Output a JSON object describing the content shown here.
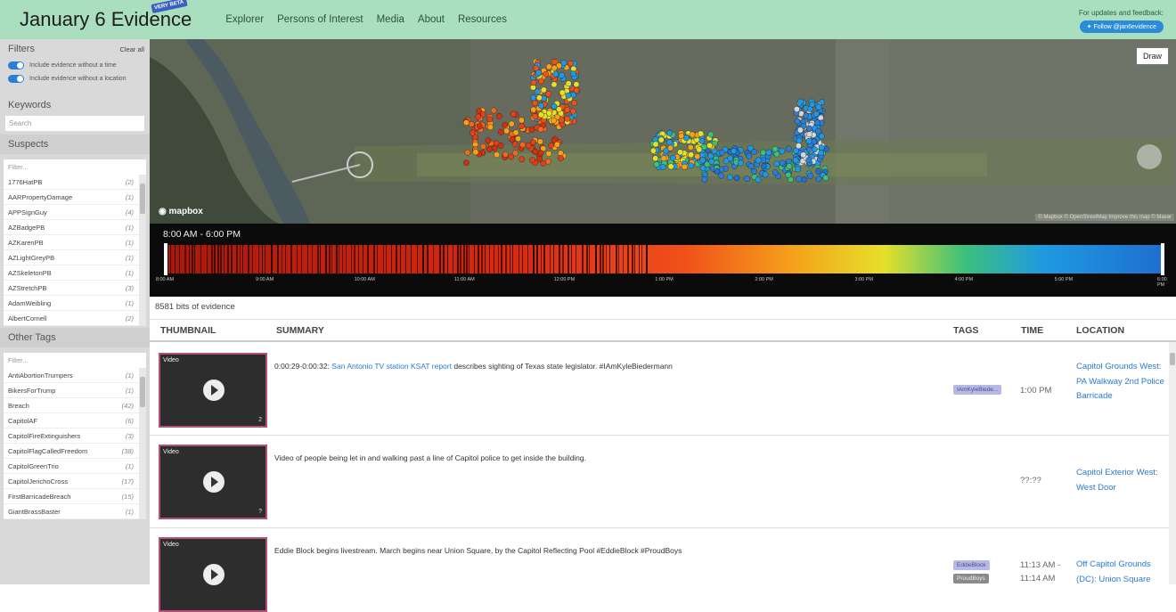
{
  "header": {
    "title": "January 6 Evidence",
    "beta_badge": "VERY BETA",
    "nav": [
      "Explorer",
      "Persons of Interest",
      "Media",
      "About",
      "Resources"
    ],
    "updates_text": "For updates and feedback:",
    "follow_label": "Follow @jan6evidence"
  },
  "sidebar": {
    "filters_title": "Filters",
    "clear_all": "Clear all",
    "toggles": [
      "Include evidence without a time",
      "Include evidence without a location"
    ],
    "keywords_title": "Keywords",
    "search_placeholder": "Search",
    "suspects_title": "Suspects",
    "suspects_filter": "Filter...",
    "suspects": [
      {
        "name": "1776HatPB",
        "count": "(2)"
      },
      {
        "name": "AARPropertyDamage",
        "count": "(1)"
      },
      {
        "name": "APPSignGuy",
        "count": "(4)"
      },
      {
        "name": "AZBadgePB",
        "count": "(1)"
      },
      {
        "name": "AZKarenPB",
        "count": "(1)"
      },
      {
        "name": "AZLightGreyPB",
        "count": "(1)"
      },
      {
        "name": "AZSkeletonPB",
        "count": "(1)"
      },
      {
        "name": "AZStretchPB",
        "count": "(3)"
      },
      {
        "name": "AdamWeibling",
        "count": "(1)"
      },
      {
        "name": "AlbertCornell",
        "count": "(2)"
      }
    ],
    "other_tags_title": "Other Tags",
    "other_filter": "Filter...",
    "other_tags": [
      {
        "name": "AntiAbortionTrumpers",
        "count": "(1)"
      },
      {
        "name": "BikersForTrump",
        "count": "(1)"
      },
      {
        "name": "Breach",
        "count": "(42)"
      },
      {
        "name": "CapitolAF",
        "count": "(6)"
      },
      {
        "name": "CapitolFireExtinguishers",
        "count": "(3)"
      },
      {
        "name": "CapitolFlagCalledFreedom",
        "count": "(38)"
      },
      {
        "name": "CapitolGreenTrio",
        "count": "(1)"
      },
      {
        "name": "CapitolJerichoCross",
        "count": "(17)"
      },
      {
        "name": "FirstBarricadeBreach",
        "count": "(15)"
      },
      {
        "name": "GiantBrassBaster",
        "count": "(1)"
      }
    ]
  },
  "map": {
    "draw_label": "Draw",
    "logo": "mapbox",
    "attribution": "© Mapbox © OpenStreetMap Improve this map © Maxar"
  },
  "timeline": {
    "range": "8:00 AM - 6:00 PM",
    "ticks": [
      "8:00 AM",
      "9:00 AM",
      "10:00 AM",
      "11:00 AM",
      "12:00 PM",
      "1:00 PM",
      "2:00 PM",
      "3:00 PM",
      "4:00 PM",
      "5:00 PM",
      "6:00 PM"
    ]
  },
  "results": {
    "count": "8581 bits of evidence",
    "columns": {
      "thumbnail": "THUMBNAIL",
      "summary": "SUMMARY",
      "tags": "TAGS",
      "time": "TIME",
      "location": "LOCATION"
    },
    "rows": [
      {
        "media": "Video",
        "media_count": "2",
        "time_prefix": "0:00:29-0:00:32:",
        "link": "San Antonio TV station KSAT report",
        "summary_rest": "describes sighting of Texas state legislator. #IAmKyleBiedermann",
        "tags": [
          "IAmKyleBiede..."
        ],
        "time": "1:00 PM",
        "location": "Capitol Grounds West: PA Walkway 2nd Police Barricade"
      },
      {
        "media": "Video",
        "media_count": "?",
        "summary": "Video of people being let in and walking past a line of Capitol police to get inside the building.",
        "tags": [],
        "time": "??:??",
        "location": "Capitol Exterior West: West Door"
      },
      {
        "media": "Video",
        "media_count": "",
        "summary": "Eddie Block begins livestream. March begins near Union Square, by the Capitol Reflecting Pool #EddieBlock #ProudBoys",
        "tags": [
          "EddieBlock",
          "ProudBoys"
        ],
        "time_a": "11:13 AM -",
        "time_b": "11:14 AM",
        "location": "Off Capitol Grounds (DC): Union Square"
      }
    ]
  },
  "colors": {
    "header_bg": "#a9dfbf",
    "accent_blue": "#2a7ad4",
    "thumb_border": "#b5507a",
    "timeline_gradient": [
      "#b01c0c",
      "#e8401a",
      "#f39a1a",
      "#e4e027",
      "#23b08a",
      "#1f8ee0",
      "#1f6fd0"
    ]
  }
}
